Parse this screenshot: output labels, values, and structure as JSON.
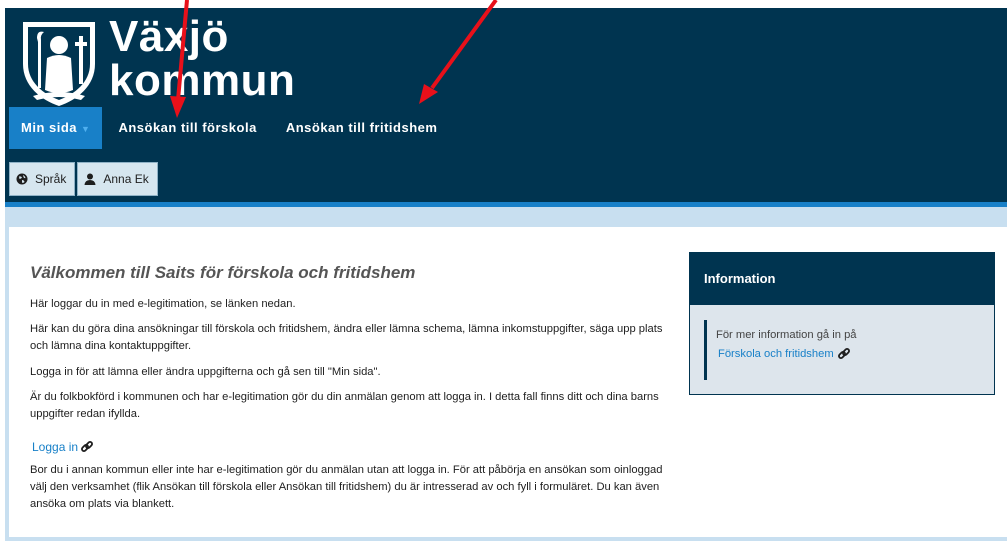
{
  "brand": {
    "line1": "Växjö",
    "line2": "kommun"
  },
  "nav": {
    "items": [
      {
        "label": "Min sida",
        "active": true
      },
      {
        "label": "Ansökan till förskola",
        "active": false
      },
      {
        "label": "Ansökan till fritidshem",
        "active": false
      }
    ],
    "caret": "▼"
  },
  "utility": {
    "language_label": "Språk",
    "user_label": "Anna Ek"
  },
  "main": {
    "title": "Välkommen till Saits för förskola och fritidshem",
    "paragraphs": [
      "Här loggar du in med e-legitimation, se länken nedan.",
      "Här kan du göra dina ansökningar till förskola och fritidshem, ändra eller lämna schema, lämna inkomstuppgifter, säga upp plats och lämna dina kontaktuppgifter.",
      "Logga in för att lämna eller ändra uppgifterna och gå sen till \"Min sida\".",
      "Är du folkbokförd i kommunen och har e-legitimation gör du din anmälan genom att logga in. I detta fall finns ditt och dina barns uppgifter redan ifyllda.",
      "Bor du i annan kommun eller inte har e-legitimation gör du anmälan utan att logga in. För att påbörja en ansökan som oinloggad välj den verksamhet (flik Ansökan till förskola eller Ansökan till fritidshem) du är intresserad av och fyll i formuläret. Du kan även ansöka om plats via blankett."
    ],
    "login_link": "Logga in"
  },
  "info": {
    "title": "Information",
    "text": "För mer information gå in på",
    "link": "Förskola och fritidshem"
  },
  "colors": {
    "header_bg": "#003450",
    "accent": "#1880c8",
    "annotation_arrow": "#e8101a"
  }
}
